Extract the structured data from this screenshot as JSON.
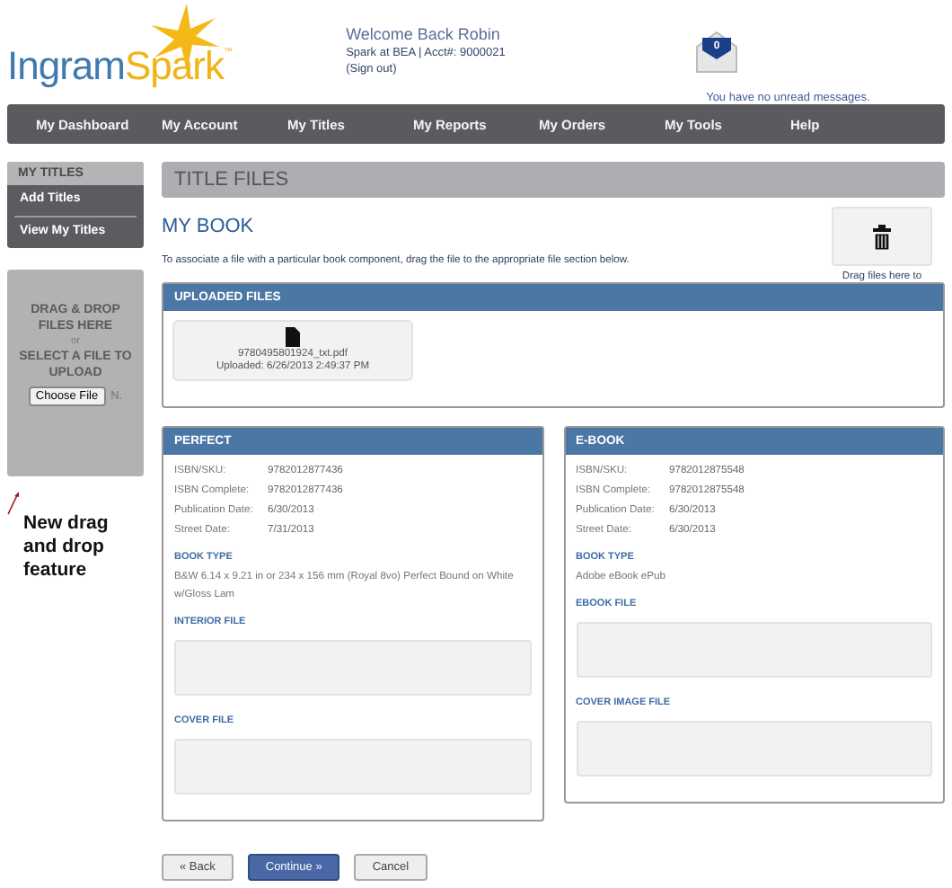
{
  "header": {
    "logo": {
      "part_1": "Ingram",
      "part_2": "Spark",
      "tm": "™"
    },
    "welcome": "Welcome Back Robin",
    "account": "Spark at BEA | Acct#: 9000021",
    "sign_out": "(Sign out)",
    "message_count": "0",
    "messages": "You have no unread messages."
  },
  "nav": [
    "My Dashboard",
    "My Account",
    "My Titles",
    "My Reports",
    "My Orders",
    "My Tools",
    "Help"
  ],
  "sidebar": {
    "title": "MY TITLES",
    "items": [
      "Add Titles",
      "View My Titles"
    ],
    "upload": {
      "line_1": "DRAG & DROP FILES HERE",
      "or": "or",
      "line_2": "SELECT A FILE TO UPLOAD",
      "button": "Choose File",
      "status": "N."
    },
    "annotation": "New drag and drop feature"
  },
  "page": {
    "title": "TITLE FILES",
    "book": "MY BOOK",
    "instructions": "To associate a file with a particular book component, drag the file to the appropriate file section below.",
    "trash_hint": "Drag files here to"
  },
  "uploaded": {
    "title": "UPLOADED FILES",
    "files": [
      {
        "name": "9780495801924_txt.pdf",
        "date": "Uploaded: 6/26/2013 2:49:37 PM"
      }
    ]
  },
  "formats": [
    {
      "title": "PERFECT",
      "fields": [
        [
          "ISBN/SKU:",
          "9782012877436"
        ],
        [
          "ISBN Complete:",
          "9782012877436"
        ],
        [
          "Publication Date:",
          "6/30/2013"
        ],
        [
          "Street Date:",
          "7/31/2013"
        ]
      ],
      "book_type_label": "BOOK TYPE",
      "book_type": "B&W 6.14 x 9.21 in or 234 x 156 mm (Royal 8vo) Perfect Bound on White w/Gloss Lam",
      "drops": [
        "INTERIOR FILE",
        "COVER FILE"
      ]
    },
    {
      "title": "E-BOOK",
      "fields": [
        [
          "ISBN/SKU:",
          "9782012875548"
        ],
        [
          "ISBN Complete:",
          "9782012875548"
        ],
        [
          "Publication Date:",
          "6/30/2013"
        ],
        [
          "Street Date:",
          "6/30/2013"
        ]
      ],
      "book_type_label": "BOOK TYPE",
      "book_type": "Adobe eBook ePub",
      "drops": [
        "EBOOK FILE",
        "COVER IMAGE FILE"
      ]
    }
  ],
  "buttons": [
    {
      "label": "« Back",
      "kind": "secondary"
    },
    {
      "label": "Continue »",
      "kind": "primary"
    },
    {
      "label": "Cancel",
      "kind": "secondary"
    }
  ]
}
